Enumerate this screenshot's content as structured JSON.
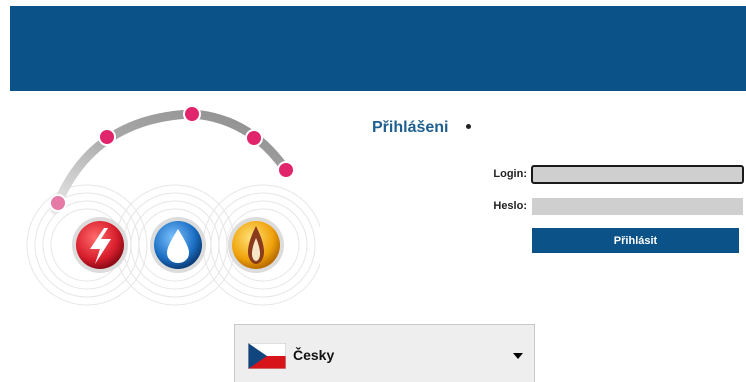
{
  "header": {
    "background": "#0a5288"
  },
  "login_panel": {
    "title": "Přihlášeni",
    "login_label": "Login:",
    "login_value": "",
    "password_label": "Heslo:",
    "password_value": "",
    "submit_label": "Přihlásit"
  },
  "logo": {
    "icons": [
      "electricity-icon",
      "water-icon",
      "gas-flame-icon"
    ],
    "colors": {
      "electricity": "#d81e2c",
      "water": "#1c6fc4",
      "gas": "#f0a30a",
      "dots": "#e0256c",
      "arc": "#9a9a9a"
    }
  },
  "language": {
    "selected": "Česky",
    "flag": "czech-flag-icon"
  }
}
